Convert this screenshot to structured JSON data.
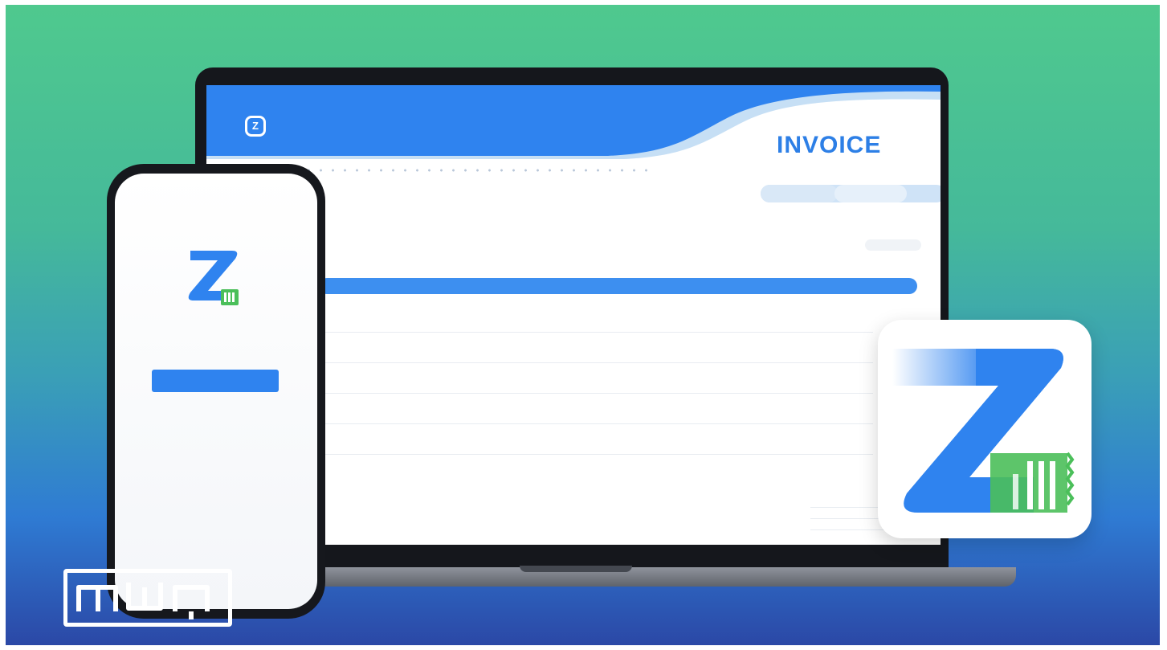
{
  "invoice": {
    "title": "INVOICE",
    "logo_glyph": "Z",
    "logo_text": "",
    "meta_left": "",
    "meta_right": "",
    "table_header_left": "",
    "table_header_right": "",
    "rows": [
      {
        "desc": "",
        "c1": "",
        "c2": ""
      },
      {
        "desc": "",
        "c1": "",
        "c2": ""
      },
      {
        "desc": "",
        "c1": "",
        "c2": ""
      },
      {
        "desc": "",
        "c1": "",
        "c2": ""
      },
      {
        "desc": "",
        "c1": "",
        "c2": ""
      }
    ],
    "totals": [
      {
        "label": "",
        "value": ""
      },
      {
        "label": "",
        "value": ""
      },
      {
        "label": "",
        "value": ""
      }
    ]
  },
  "laptop": {
    "label": ""
  },
  "phone": {
    "app_name": "",
    "tagline": "",
    "button_label": "",
    "link_text": ""
  },
  "app_icon": {
    "name": "zoho-invoice-app-icon"
  },
  "watermark": {
    "name": "mwn-logo"
  },
  "colors": {
    "accent_blue": "#2f83ef",
    "invoice_title": "#2d7fe6",
    "icon_green": "#4bbf5a",
    "bg_top": "#4fc98e",
    "bg_bottom": "#2b48a6"
  }
}
